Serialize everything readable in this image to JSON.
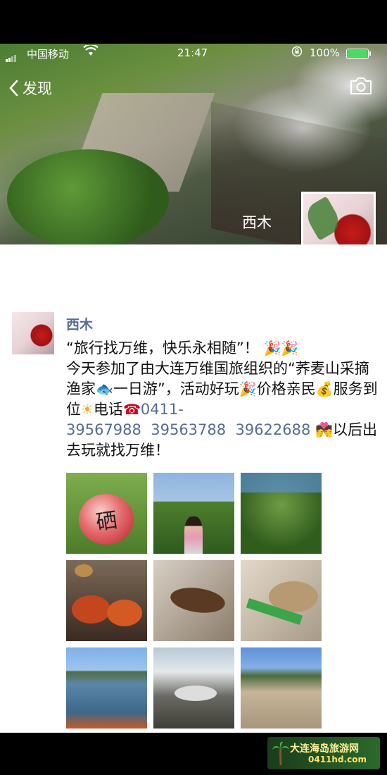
{
  "status": {
    "carrier": "中国移动",
    "time": "21:47",
    "battery": "100%",
    "battery_level": 1.0
  },
  "nav": {
    "back_label": "发现",
    "back_icon": "chevron-left-icon",
    "camera_icon": "camera-icon"
  },
  "profile": {
    "name": "西木"
  },
  "post": {
    "author": "西木",
    "line1": "“旅行找万维，快乐永相随”！",
    "line2a": "今天参加了由大连万维国旅组织的“荞麦山采摘渔家",
    "line2b": "一日游”，活动好玩",
    "line2c": "价格亲民",
    "line2d": "服务到位",
    "line2e": "电话",
    "phone1": "0411-",
    "phones": "39567988  39563788  39622688",
    "line2f": "以后出去玩就找万维！",
    "emoji_party": "🎉",
    "emoji_fish": "🐟",
    "emoji_money": "💰",
    "emoji_sun": "☀",
    "emoji_phone": "☎",
    "emoji_couple": "💏"
  },
  "photos": [
    {
      "name": "apple",
      "text": "硒"
    },
    {
      "name": "apple-tree-girl"
    },
    {
      "name": "apple-tree"
    },
    {
      "name": "bbq-crabs"
    },
    {
      "name": "grilled-fish"
    },
    {
      "name": "fish-dish"
    },
    {
      "name": "harbor-beach"
    },
    {
      "name": "group-table"
    },
    {
      "name": "group-game"
    }
  ],
  "watermark": {
    "title": "大连海岛旅游网",
    "url": "0411hd.com"
  }
}
